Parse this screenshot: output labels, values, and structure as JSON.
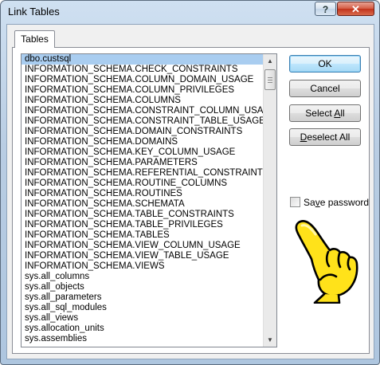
{
  "window": {
    "title": "Link Tables",
    "help_label": "?",
    "close_label": "✕"
  },
  "tab": {
    "label": "Tables"
  },
  "tables": [
    "dbo.custsql",
    "INFORMATION_SCHEMA.CHECK_CONSTRAINTS",
    "INFORMATION_SCHEMA.COLUMN_DOMAIN_USAGE",
    "INFORMATION_SCHEMA.COLUMN_PRIVILEGES",
    "INFORMATION_SCHEMA.COLUMNS",
    "INFORMATION_SCHEMA.CONSTRAINT_COLUMN_USAGE",
    "INFORMATION_SCHEMA.CONSTRAINT_TABLE_USAGE",
    "INFORMATION_SCHEMA.DOMAIN_CONSTRAINTS",
    "INFORMATION_SCHEMA.DOMAINS",
    "INFORMATION_SCHEMA.KEY_COLUMN_USAGE",
    "INFORMATION_SCHEMA.PARAMETERS",
    "INFORMATION_SCHEMA.REFERENTIAL_CONSTRAINTS",
    "INFORMATION_SCHEMA.ROUTINE_COLUMNS",
    "INFORMATION_SCHEMA.ROUTINES",
    "INFORMATION_SCHEMA.SCHEMATA",
    "INFORMATION_SCHEMA.TABLE_CONSTRAINTS",
    "INFORMATION_SCHEMA.TABLE_PRIVILEGES",
    "INFORMATION_SCHEMA.TABLES",
    "INFORMATION_SCHEMA.VIEW_COLUMN_USAGE",
    "INFORMATION_SCHEMA.VIEW_TABLE_USAGE",
    "INFORMATION_SCHEMA.VIEWS",
    "sys.all_columns",
    "sys.all_objects",
    "sys.all_parameters",
    "sys.all_sql_modules",
    "sys.all_views",
    "sys.allocation_units",
    "sys.assemblies"
  ],
  "selected_index": 0,
  "buttons": {
    "ok": "OK",
    "cancel": "Cancel",
    "select_all": "Select All",
    "deselect_all": "Deselect All"
  },
  "save_password": {
    "label": "Save password",
    "checked": false
  },
  "icons": {
    "pointer": "pointing-hand-icon",
    "scroll_up": "chevron-up-icon",
    "scroll_down": "chevron-down-icon"
  }
}
